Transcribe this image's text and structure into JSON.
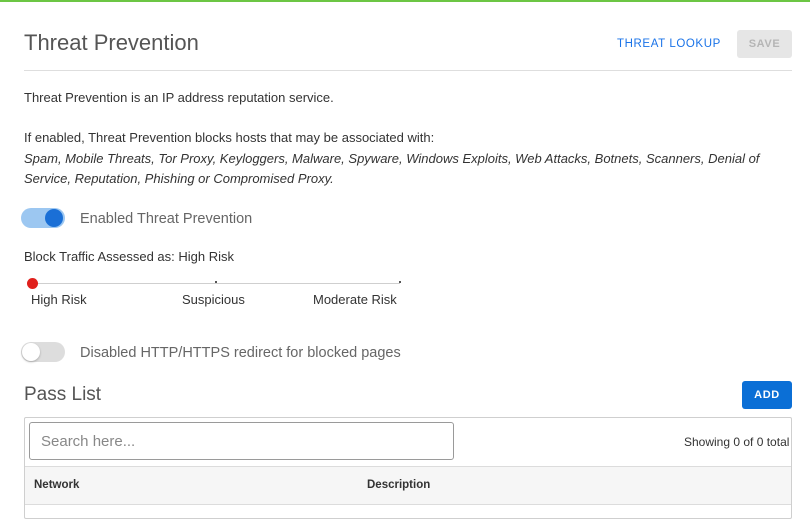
{
  "header": {
    "title": "Threat Prevention",
    "lookup_label": "THREAT LOOKUP",
    "save_label": "SAVE"
  },
  "description": "Threat Prevention is an IP address reputation service.",
  "threats": {
    "intro": "If enabled, Threat Prevention blocks hosts that may be associated with:",
    "list": "Spam, Mobile Threats, Tor Proxy, Keyloggers, Malware, Spyware, Windows Exploits, Web Attacks, Botnets, Scanners, Denial of Service, Reputation, Phishing or Compromised Proxy."
  },
  "enable_toggle": {
    "label": "Enabled Threat Prevention",
    "on": true
  },
  "block_traffic": {
    "label": "Block Traffic Assessed as: High Risk",
    "levels": [
      "High Risk",
      "Suspicious",
      "Moderate Risk"
    ],
    "selected_index": 0
  },
  "redirect_toggle": {
    "label": "Disabled HTTP/HTTPS redirect for blocked pages",
    "on": false
  },
  "pass_list": {
    "title": "Pass List",
    "add_label": "ADD",
    "search_placeholder": "Search here...",
    "showing_text": "Showing 0 of 0 total",
    "columns": [
      "Network",
      "Description"
    ]
  },
  "colors": {
    "accent": "#1a73e8",
    "add_button": "#0b6fd6",
    "top_bar": "#6cc644",
    "slider_thumb": "#e0201c"
  }
}
